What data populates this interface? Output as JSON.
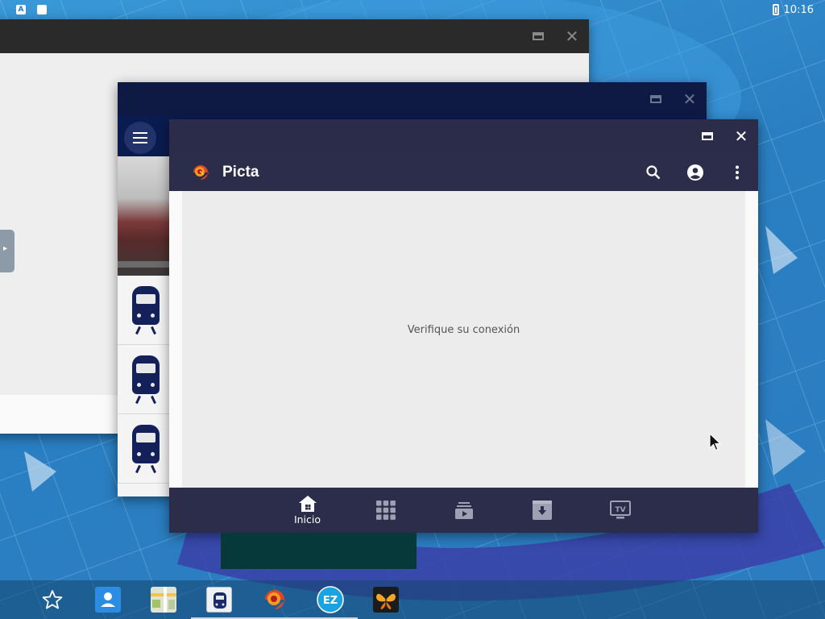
{
  "status_bar": {
    "time": "10:16",
    "left_icons": [
      "a-letter-icon",
      "sd-card-icon"
    ]
  },
  "windows": {
    "back_window": {
      "controls": [
        "maximize",
        "close"
      ]
    },
    "middle_window": {
      "controls": [
        "maximize",
        "close"
      ],
      "app_icon": "train-icon"
    },
    "front_window": {
      "app_name": "Picta",
      "message": "Verifique su conexión",
      "actions": [
        "search-icon",
        "account-icon",
        "more-vert-icon"
      ],
      "bottom_nav": [
        {
          "label": "Inicio",
          "icon": "home-icon",
          "active": true
        },
        {
          "label": "",
          "icon": "apps-grid-icon",
          "active": false
        },
        {
          "label": "",
          "icon": "video-library-icon",
          "active": false
        },
        {
          "label": "",
          "icon": "download-icon",
          "active": false
        },
        {
          "label": "",
          "icon": "tv-icon",
          "active": false
        }
      ]
    }
  },
  "taskbar": {
    "items": [
      {
        "icon": "star-icon",
        "running": false
      },
      {
        "icon": "contacts-icon",
        "running": false
      },
      {
        "icon": "map-icon",
        "running": false
      },
      {
        "icon": "train-app-icon",
        "running": true
      },
      {
        "icon": "picta-app-icon",
        "running": true
      },
      {
        "icon": "ez-app-icon",
        "running": true
      },
      {
        "icon": "butterfly-app-icon",
        "running": false
      }
    ]
  },
  "colors": {
    "picta_bar": "#2b2d4a",
    "trains_bar": "#0a1b4f",
    "wallpaper": "#2b7cc0"
  }
}
